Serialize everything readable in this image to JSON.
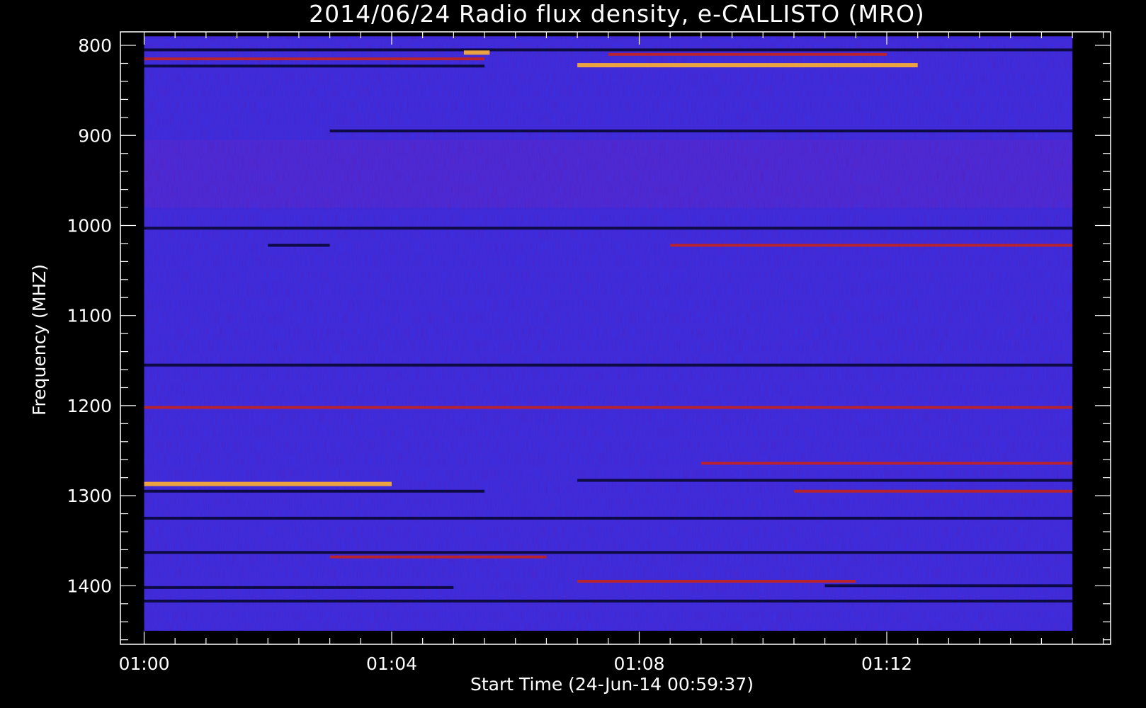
{
  "chart_data": {
    "type": "heatmap",
    "title": "2014/06/24  Radio flux density, e-CALLISTO (MRO)",
    "xlabel": "Start Time (24-Jun-14 00:59:37)",
    "ylabel": "Frequency (MHZ)",
    "x_tick_labels": [
      "01:00",
      "01:04",
      "01:08",
      "01:12"
    ],
    "y_tick_labels": [
      "800",
      "900",
      "1000",
      "1100",
      "1200",
      "1300",
      "1400"
    ],
    "x_ticks": [
      "01:00",
      "01:04",
      "01:08",
      "01:12"
    ],
    "y_ticks": [
      800,
      900,
      1000,
      1100,
      1200,
      1300,
      1400
    ],
    "xlim": [
      "00:59:37",
      "01:15:37"
    ],
    "ylim": [
      1465,
      785
    ],
    "data_time_range": [
      "01:00:00",
      "01:15:00"
    ],
    "data_freq_range": [
      790,
      1450
    ],
    "colormap": {
      "background": "#3b2ee0",
      "dark": "#05052a",
      "warm": "#c4241c",
      "hot": "#ffb030"
    },
    "frame_color": "#ffffff",
    "bands": [
      {
        "freq": 805,
        "t0": "01:00:00",
        "t1": "01:15:00",
        "level": "dark"
      },
      {
        "freq": 815,
        "t0": "01:00:00",
        "t1": "01:05:30",
        "level": "warm"
      },
      {
        "freq": 823,
        "t0": "01:00:00",
        "t1": "01:05:30",
        "level": "dark"
      },
      {
        "freq": 808,
        "t0": "01:05:10",
        "t1": "01:05:35",
        "level": "hot"
      },
      {
        "freq": 822,
        "t0": "01:07:00",
        "t1": "01:12:30",
        "level": "hot"
      },
      {
        "freq": 810,
        "t0": "01:07:30",
        "t1": "01:12:00",
        "level": "warm"
      },
      {
        "freq": 895,
        "t0": "01:03:00",
        "t1": "01:15:00",
        "level": "dark"
      },
      {
        "freq": 1003,
        "t0": "01:00:00",
        "t1": "01:15:00",
        "level": "dark"
      },
      {
        "freq": 1022,
        "t0": "01:08:30",
        "t1": "01:15:00",
        "level": "warm"
      },
      {
        "freq": 1022,
        "t0": "01:02:00",
        "t1": "01:03:00",
        "level": "dark"
      },
      {
        "freq": 1155,
        "t0": "01:00:00",
        "t1": "01:15:00",
        "level": "dark"
      },
      {
        "freq": 1202,
        "t0": "01:00:00",
        "t1": "01:15:00",
        "level": "warm"
      },
      {
        "freq": 1264,
        "t0": "01:09:00",
        "t1": "01:15:00",
        "level": "warm"
      },
      {
        "freq": 1287,
        "t0": "01:00:00",
        "t1": "01:04:00",
        "level": "hot"
      },
      {
        "freq": 1295,
        "t0": "01:00:00",
        "t1": "01:05:30",
        "level": "dark"
      },
      {
        "freq": 1295,
        "t0": "01:10:30",
        "t1": "01:15:00",
        "level": "warm"
      },
      {
        "freq": 1283,
        "t0": "01:07:00",
        "t1": "01:15:00",
        "level": "dark"
      },
      {
        "freq": 1325,
        "t0": "01:00:00",
        "t1": "01:15:00",
        "level": "dark"
      },
      {
        "freq": 1363,
        "t0": "01:00:00",
        "t1": "01:15:00",
        "level": "dark"
      },
      {
        "freq": 1368,
        "t0": "01:03:00",
        "t1": "01:06:30",
        "level": "warm"
      },
      {
        "freq": 1395,
        "t0": "01:07:00",
        "t1": "01:11:30",
        "level": "warm"
      },
      {
        "freq": 1402,
        "t0": "01:00:00",
        "t1": "01:05:00",
        "level": "dark"
      },
      {
        "freq": 1400,
        "t0": "01:11:00",
        "t1": "01:15:00",
        "level": "dark"
      },
      {
        "freq": 1417,
        "t0": "01:00:00",
        "t1": "01:15:00",
        "level": "dark"
      }
    ]
  }
}
